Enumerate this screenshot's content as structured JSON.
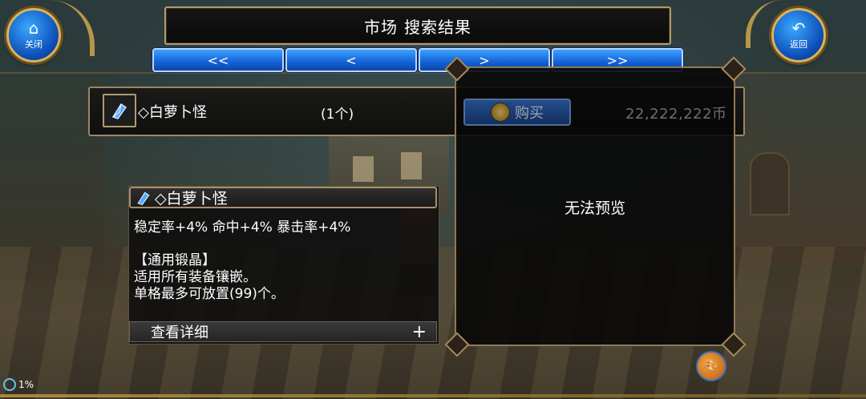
{
  "header": {
    "title_part1": "市场",
    "title_part2": "搜索结果",
    "close_label": "关闭",
    "back_label": "返回"
  },
  "pager": {
    "first": "<<",
    "prev": "<",
    "next": ">",
    "last": ">>"
  },
  "item": {
    "name": "◇白萝卜怪",
    "quantity": "(1个)",
    "buy_label": "购买",
    "price": "22,222,222币"
  },
  "preview": {
    "text": "无法预览"
  },
  "detail": {
    "name": "◇白萝卜怪",
    "stats": "稳定率+4% 命中+4% 暴击率+4%",
    "category": "【通用锻晶】",
    "line1": "适用所有装备镶嵌。",
    "line2": "单格最多可放置(99)个。",
    "more_label": "查看详细",
    "expand_symbol": "+"
  },
  "status": {
    "percent": "1%"
  },
  "icons": {
    "close": "home-icon",
    "back": "return-icon",
    "gem": "blue-crystal-icon",
    "buy": "coin-icon",
    "palette": "palette-icon"
  },
  "colors": {
    "accent_gold": "#b39a6b",
    "button_blue": "#1461d4",
    "price_gray": "#6b6f72"
  }
}
